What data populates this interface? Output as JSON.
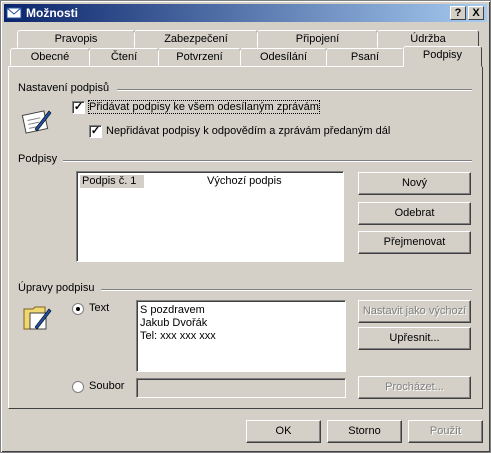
{
  "window": {
    "title": "Možnosti",
    "help_btn": "?",
    "close_btn": "X"
  },
  "tabs_row1": [
    "Pravopis",
    "Zabezpečení",
    "Připojení",
    "Údržba"
  ],
  "tabs_row2": [
    "Obecné",
    "Čtení",
    "Potvrzení",
    "Odesílání",
    "Psaní",
    "Podpisy"
  ],
  "active_tab": "Podpisy",
  "settings": {
    "group": "Nastavení podpisů",
    "opt_all": {
      "label": "Přidávat podpisy ke všem odesílaným zprávám",
      "checked": true
    },
    "opt_noreply": {
      "label": "Nepřidávat podpisy k odpovědím a zprávám předaným dál",
      "checked": true
    }
  },
  "signatures": {
    "group": "Podpisy",
    "rows": [
      {
        "name": "Podpis č. 1",
        "status": "Výchozí podpis"
      }
    ],
    "btn_new": "Nový",
    "btn_remove": "Odebrat",
    "btn_rename": "Přejmenovat"
  },
  "edit": {
    "group": "Úpravy podpisu",
    "radio_text": "Text",
    "radio_file": "Soubor",
    "text_lines": [
      "S pozdravem",
      "Jakub Dvořák",
      "Tel: xxx xxx xxx"
    ],
    "btn_default": "Nastavit jako výchozí",
    "btn_advanced": "Upřesnit...",
    "btn_browse": "Procházet..."
  },
  "footer": {
    "ok": "OK",
    "cancel": "Storno",
    "apply": "Použít"
  }
}
